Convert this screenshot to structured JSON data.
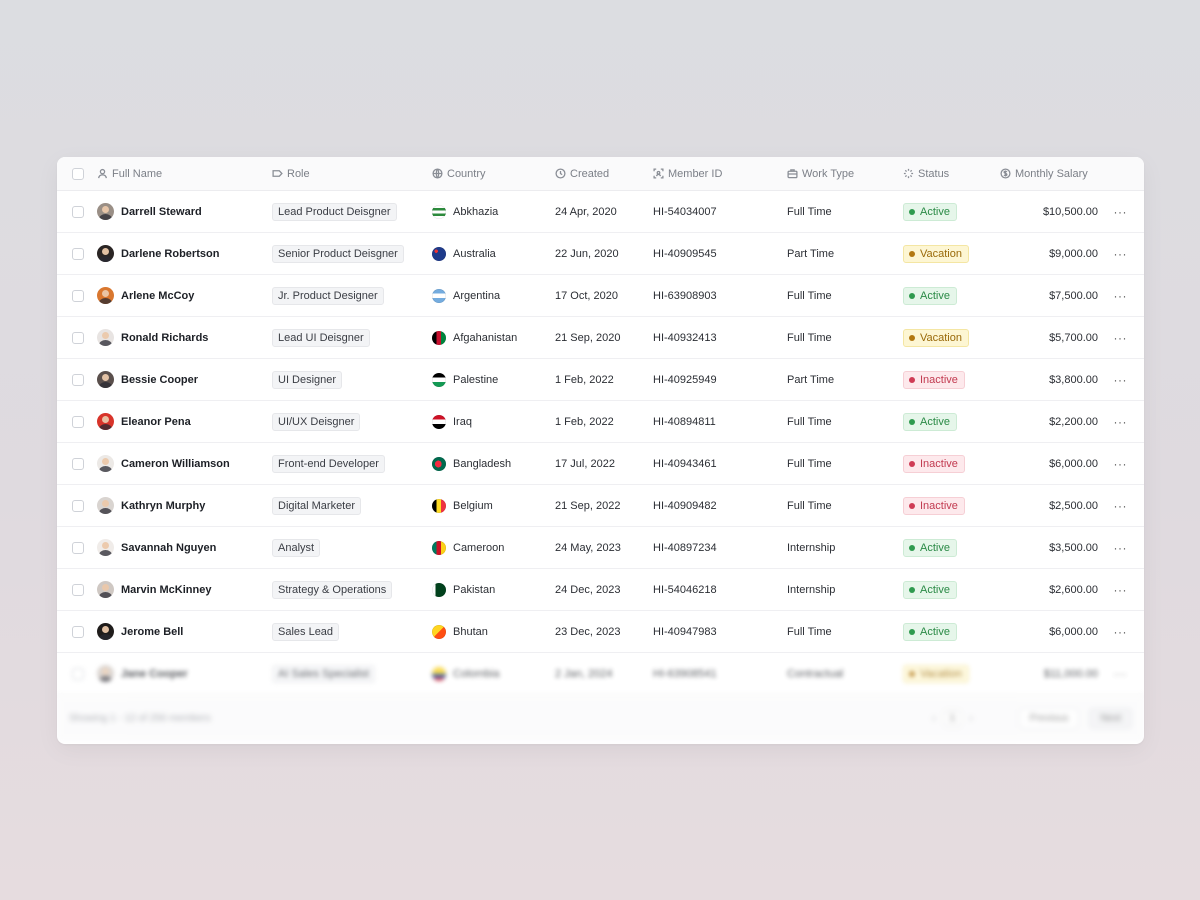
{
  "table": {
    "columns": [
      {
        "label": "Full Name",
        "icon": "user-icon"
      },
      {
        "label": "Role",
        "icon": "tag-icon"
      },
      {
        "label": "Country",
        "icon": "globe-icon"
      },
      {
        "label": "Created",
        "icon": "clock-icon"
      },
      {
        "label": "Member ID",
        "icon": "id-scan-icon"
      },
      {
        "label": "Work Type",
        "icon": "briefcase-icon"
      },
      {
        "label": "Status",
        "icon": "loader-icon"
      },
      {
        "label": "Monthly Salary",
        "icon": "dollar-circle-icon"
      }
    ],
    "rows": [
      {
        "name": "Darrell Steward",
        "role": "Lead Product Deisgner",
        "country": "Abkhazia",
        "flag": "linear-gradient(180deg,#fff 0 20%,#2c8a3c 20% 40%,#fff 40% 60%,#2c8a3c 60% 80%,#fff 80%)",
        "created": "24 Apr, 2020",
        "member_id": "HI-54034007",
        "work_type": "Full Time",
        "status": "Active",
        "salary": "$10,500.00",
        "avatar": "#9a8f86"
      },
      {
        "name": "Darlene Robertson",
        "role": "Senior Product Deisgner",
        "country": "Australia",
        "flag": "radial-gradient(circle at 30% 30%,#e33 0 12%,#1e3a8a 13%)",
        "created": "22 Jun, 2020",
        "member_id": "HI-40909545",
        "work_type": "Part Time",
        "status": "Vacation",
        "salary": "$9,000.00",
        "avatar": "#2a2524"
      },
      {
        "name": "Arlene McCoy",
        "role": "Jr. Product Designer",
        "country": "Argentina",
        "flag": "linear-gradient(180deg,#74acdf 0 33%,#ffffff 33% 66%,#74acdf 66%)",
        "created": "17 Oct, 2020",
        "member_id": "HI-63908903",
        "work_type": "Full Time",
        "status": "Active",
        "salary": "$7,500.00",
        "avatar": "#d9772f"
      },
      {
        "name": "Ronald Richards",
        "role": "Lead UI Deisgner",
        "country": "Afgahanistan",
        "flag": "linear-gradient(90deg,#000 0 33%,#c8102e 33% 66%,#00843d 66%)",
        "created": "21 Sep, 2020",
        "member_id": "HI-40932413",
        "work_type": "Full Time",
        "status": "Vacation",
        "salary": "$5,700.00",
        "avatar": "#e8e4e2"
      },
      {
        "name": "Bessie Cooper",
        "role": "UI Designer",
        "country": "Palestine",
        "flag": "linear-gradient(180deg,#000 0 33%,#fff 33% 66%,#149954 66%)",
        "created": "1 Feb, 2022",
        "member_id": "HI-40925949",
        "work_type": "Part Time",
        "status": "Inactive",
        "salary": "$3,800.00",
        "avatar": "#5a4f4c"
      },
      {
        "name": "Eleanor Pena",
        "role": "UI/UX Deisgner",
        "country": "Iraq",
        "flag": "linear-gradient(180deg,#ce1126 0 33%,#fff 33% 66%,#000 66%)",
        "created": "1 Feb, 2022",
        "member_id": "HI-40894811",
        "work_type": "Full Time",
        "status": "Active",
        "salary": "$2,200.00",
        "avatar": "#d8342a"
      },
      {
        "name": "Cameron Williamson",
        "role": "Front-end Developer",
        "country": "Bangladesh",
        "flag": "radial-gradient(circle at 45% 50%,#f42a41 0 32%,#006a4e 33%)",
        "created": "17 Jul, 2022",
        "member_id": "HI-40943461",
        "work_type": "Full Time",
        "status": "Inactive",
        "salary": "$6,000.00",
        "avatar": "#ece9e6"
      },
      {
        "name": "Kathryn Murphy",
        "role": "Digital Marketer",
        "country": "Belgium",
        "flag": "linear-gradient(90deg,#000 0 33%,#fdda24 33% 66%,#ef3340 66%)",
        "created": "21 Sep, 2022",
        "member_id": "HI-40909482",
        "work_type": "Full Time",
        "status": "Inactive",
        "salary": "$2,500.00",
        "avatar": "#d9d4d0"
      },
      {
        "name": "Savannah Nguyen",
        "role": "Analyst",
        "country": "Cameroon",
        "flag": "linear-gradient(90deg,#007a5e 0 33%,#ce1126 33% 66%,#fcd116 66%)",
        "created": "24 May, 2023",
        "member_id": "HI-40897234",
        "work_type": "Internship",
        "status": "Active",
        "salary": "$3,500.00",
        "avatar": "#f0ece9"
      },
      {
        "name": "Marvin McKinney",
        "role": "Strategy & Operations",
        "country": "Pakistan",
        "flag": "linear-gradient(90deg,#fff 0 25%,#01411c 25%)",
        "created": "24 Dec, 2023",
        "member_id": "HI-54046218",
        "work_type": "Internship",
        "status": "Active",
        "salary": "$2,600.00",
        "avatar": "#cfc8c3"
      },
      {
        "name": "Jerome Bell",
        "role": "Sales Lead",
        "country": "Bhutan",
        "flag": "linear-gradient(135deg,#ffd520 0 50%,#ff4e12 50%)",
        "created": "23 Dec, 2023",
        "member_id": "HI-40947983",
        "work_type": "Full Time",
        "status": "Active",
        "salary": "$6,000.00",
        "avatar": "#1f1c1b"
      },
      {
        "name": "Jane Cooper",
        "role": "AI Sales Specialist",
        "country": "Colombia",
        "flag": "linear-gradient(180deg,#fcd116 0 50%,#003893 50% 75%,#ce1126 75%)",
        "created": "2 Jan, 2024",
        "member_id": "HI-63908541",
        "work_type": "Contractual",
        "status": "Vacation",
        "salary": "$11,000.00",
        "avatar": "#cfc8c3"
      }
    ],
    "row_action_icon": "more-horizontal-icon"
  },
  "statuses": {
    "Active": {
      "bg": "#e6f6ea",
      "border": "#cdebd5",
      "text": "#2a8a46",
      "dot": "#2f9a4f"
    },
    "Vacation": {
      "bg": "#fdf6d3",
      "border": "#f4e6a3",
      "text": "#9a6a0a",
      "dot": "#b27811"
    },
    "Inactive": {
      "bg": "#fde9ec",
      "border": "#f6cfd5",
      "text": "#c23a50",
      "dot": "#cf3c55"
    }
  },
  "footer": {
    "summary": "Showing 1 - 12 of 256 members",
    "page_prev": "‹",
    "page_current": "1",
    "page_next": "›",
    "previous_label": "Previous",
    "next_label": "Next"
  }
}
